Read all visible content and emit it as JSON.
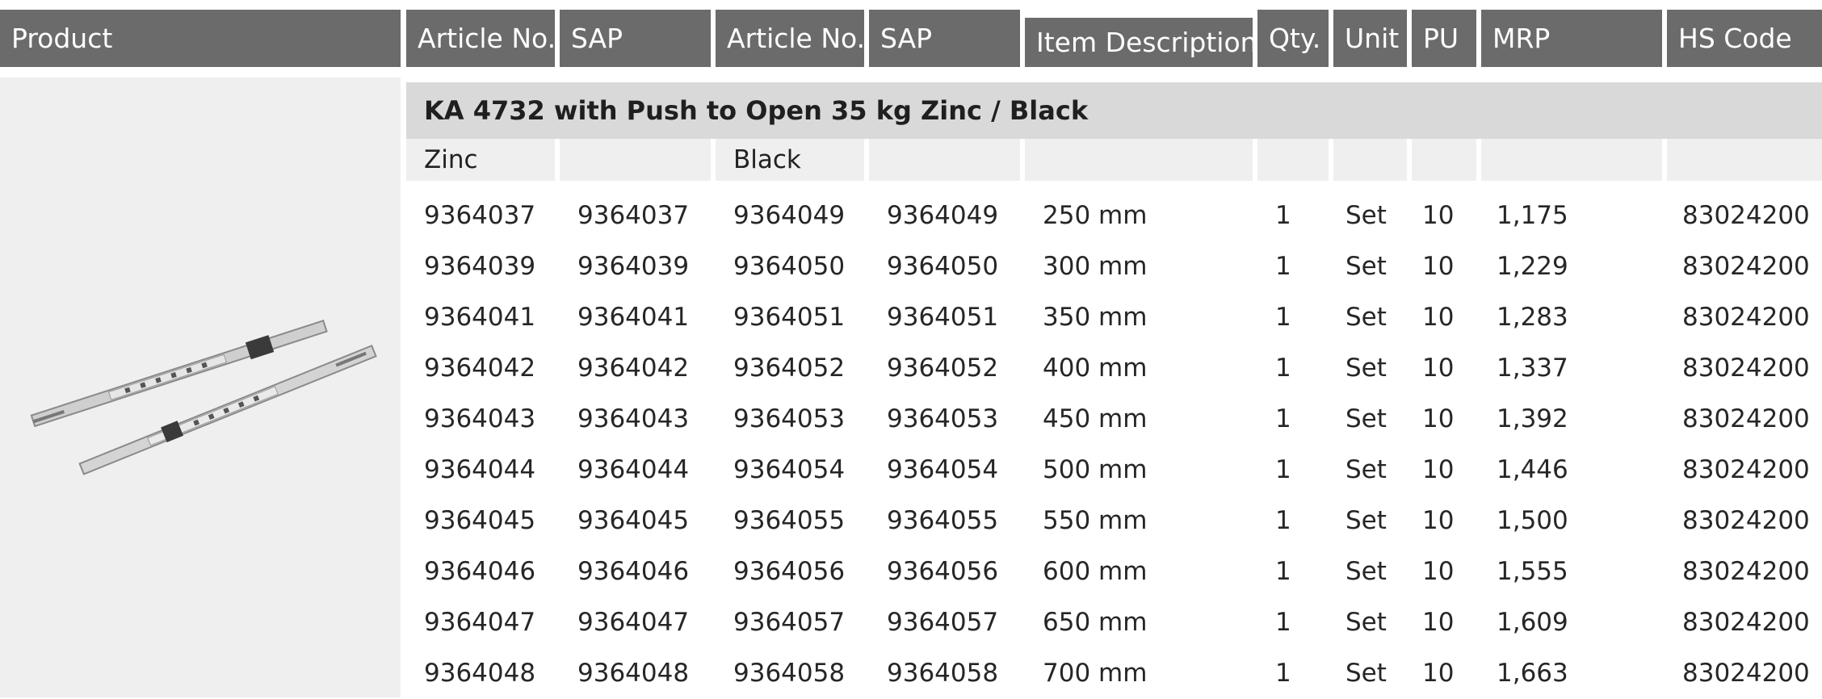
{
  "header": {
    "columns": [
      "Product",
      "Article No.",
      "SAP",
      "Article No.",
      "SAP",
      "Item Description",
      "Qty.",
      "Unit",
      "PU",
      "MRP",
      "HS Code"
    ]
  },
  "section": {
    "title": "KA 4732 with Push to Open 35 kg Zinc / Black",
    "finish_zinc": "Zinc",
    "finish_black": "Black"
  },
  "rows": [
    {
      "art_zinc": "9364037",
      "sap_zinc": "9364037",
      "art_black": "9364049",
      "sap_black": "9364049",
      "desc": "250 mm",
      "qty": "1",
      "unit": "Set",
      "pu": "10",
      "mrp": "1,175",
      "hs": "83024200"
    },
    {
      "art_zinc": "9364039",
      "sap_zinc": "9364039",
      "art_black": "9364050",
      "sap_black": "9364050",
      "desc": "300 mm",
      "qty": "1",
      "unit": "Set",
      "pu": "10",
      "mrp": "1,229",
      "hs": "83024200"
    },
    {
      "art_zinc": "9364041",
      "sap_zinc": "9364041",
      "art_black": "9364051",
      "sap_black": "9364051",
      "desc": "350 mm",
      "qty": "1",
      "unit": "Set",
      "pu": "10",
      "mrp": "1,283",
      "hs": "83024200"
    },
    {
      "art_zinc": "9364042",
      "sap_zinc": "9364042",
      "art_black": "9364052",
      "sap_black": "9364052",
      "desc": "400 mm",
      "qty": "1",
      "unit": "Set",
      "pu": "10",
      "mrp": "1,337",
      "hs": "83024200"
    },
    {
      "art_zinc": "9364043",
      "sap_zinc": "9364043",
      "art_black": "9364053",
      "sap_black": "9364053",
      "desc": "450 mm",
      "qty": "1",
      "unit": "Set",
      "pu": "10",
      "mrp": "1,392",
      "hs": "83024200"
    },
    {
      "art_zinc": "9364044",
      "sap_zinc": "9364044",
      "art_black": "9364054",
      "sap_black": "9364054",
      "desc": "500 mm",
      "qty": "1",
      "unit": "Set",
      "pu": "10",
      "mrp": "1,446",
      "hs": "83024200"
    },
    {
      "art_zinc": "9364045",
      "sap_zinc": "9364045",
      "art_black": "9364055",
      "sap_black": "9364055",
      "desc": "550 mm",
      "qty": "1",
      "unit": "Set",
      "pu": "10",
      "mrp": "1,500",
      "hs": "83024200"
    },
    {
      "art_zinc": "9364046",
      "sap_zinc": "9364046",
      "art_black": "9364056",
      "sap_black": "9364056",
      "desc": "600 mm",
      "qty": "1",
      "unit": "Set",
      "pu": "10",
      "mrp": "1,555",
      "hs": "83024200"
    },
    {
      "art_zinc": "9364047",
      "sap_zinc": "9364047",
      "art_black": "9364057",
      "sap_black": "9364057",
      "desc": "650 mm",
      "qty": "1",
      "unit": "Set",
      "pu": "10",
      "mrp": "1,609",
      "hs": "83024200"
    },
    {
      "art_zinc": "9364048",
      "sap_zinc": "9364048",
      "art_black": "9364058",
      "sap_black": "9364058",
      "desc": "700 mm",
      "qty": "1",
      "unit": "Set",
      "pu": "10",
      "mrp": "1,663",
      "hs": "83024200"
    }
  ],
  "colors": {
    "header_bg": "#6b6b6b",
    "title_bg": "#d9d9d9",
    "cell_bg": "#efefef"
  }
}
